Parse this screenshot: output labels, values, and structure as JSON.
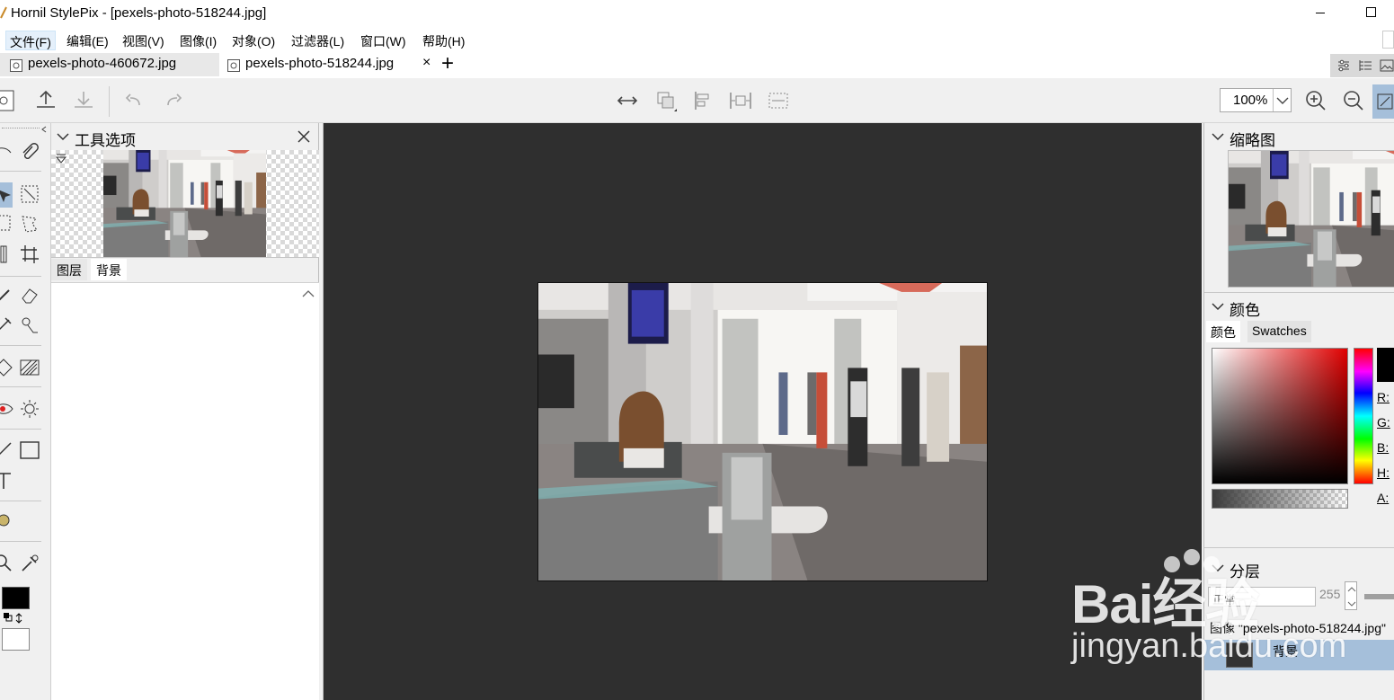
{
  "window": {
    "title": "Hornil StylePix - [pexels-photo-518244.jpg]",
    "minimize_icon": "minimize-icon",
    "maximize_icon": "maximize-icon"
  },
  "menu": {
    "items": [
      {
        "label": "文件(F)",
        "active": true
      },
      {
        "label": "编辑(E)"
      },
      {
        "label": "视图(V)"
      },
      {
        "label": "图像(I)"
      },
      {
        "label": "对象(O)"
      },
      {
        "label": "过滤器(L)"
      },
      {
        "label": "窗口(W)"
      },
      {
        "label": "帮助(H)"
      }
    ]
  },
  "tabs": {
    "items": [
      {
        "label": "pexels-photo-460672.jpg",
        "active": false
      },
      {
        "label": "pexels-photo-518244.jpg",
        "active": true
      }
    ],
    "close_glyph": "×",
    "new_tab_glyph": "+"
  },
  "toolbar": {
    "zoom": "100%"
  },
  "tool_options": {
    "title": "工具选项",
    "tab_layers": "图层",
    "tab_background": "背景"
  },
  "right_panel": {
    "thumbnail_title": "缩略图",
    "color_title": "颜色",
    "color_tab": "颜色",
    "swatches_tab": "Swatches",
    "channels": [
      "R:",
      "G:",
      "B:",
      "H:",
      "A:"
    ],
    "current_color": "#000000",
    "layers_title": "分层",
    "blend_mode": "正常",
    "opacity": "255",
    "image_label": "图像 \"pexels-photo-518244.jpg\"",
    "layer_name": "背景"
  },
  "watermark": {
    "brand": "Bai经验",
    "url": "jingyan.baidu.com"
  },
  "colors": {
    "canvas_bg": "#2f2f2f",
    "selection": "#a5bfda",
    "menu_active": "#e5f0fb"
  }
}
